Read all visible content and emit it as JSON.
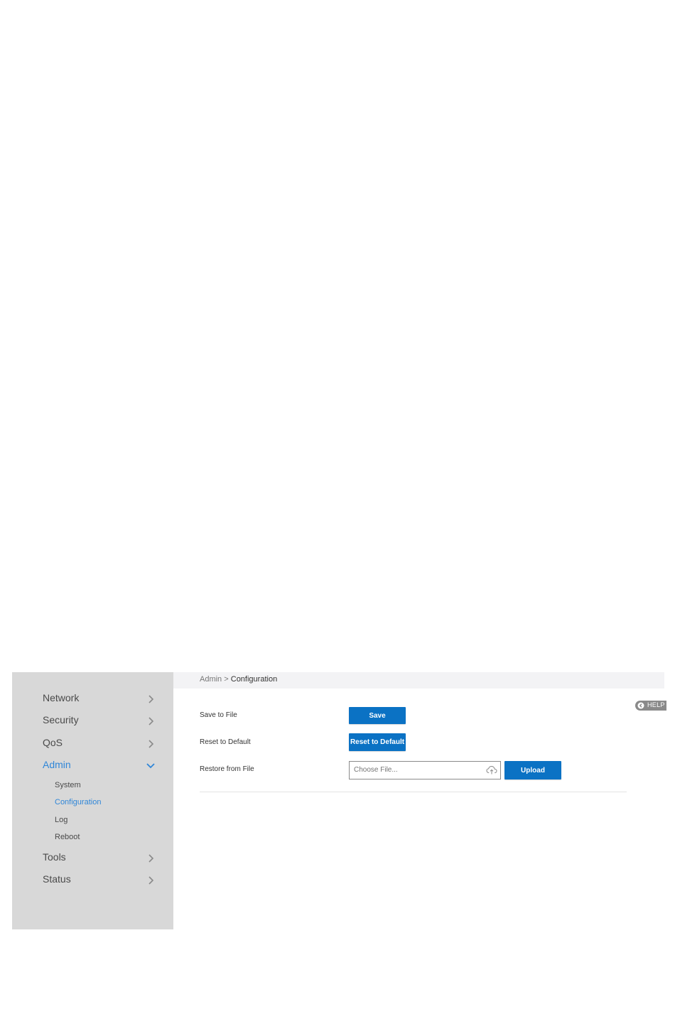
{
  "sidebar": {
    "items": [
      {
        "label": "Network"
      },
      {
        "label": "Security"
      },
      {
        "label": "QoS"
      },
      {
        "label": "Admin"
      },
      {
        "label": "Tools"
      },
      {
        "label": "Status"
      }
    ],
    "admin_subitems": [
      {
        "label": "System"
      },
      {
        "label": "Configuration"
      },
      {
        "label": "Log"
      },
      {
        "label": "Reboot"
      }
    ]
  },
  "breadcrumb": {
    "parent": "Admin",
    "separator": ">",
    "current": "Configuration"
  },
  "help": {
    "label": "HELP"
  },
  "config": {
    "save_label": "Save to File",
    "save_button": "Save",
    "reset_label": "Reset to Default",
    "reset_button": "Reset to Default",
    "restore_label": "Restore from File",
    "file_placeholder": "Choose File...",
    "upload_button": "Upload"
  },
  "colors": {
    "accent": "#2f86d8",
    "button": "#0b72c4",
    "sidebar_bg": "#d8d8d8"
  }
}
